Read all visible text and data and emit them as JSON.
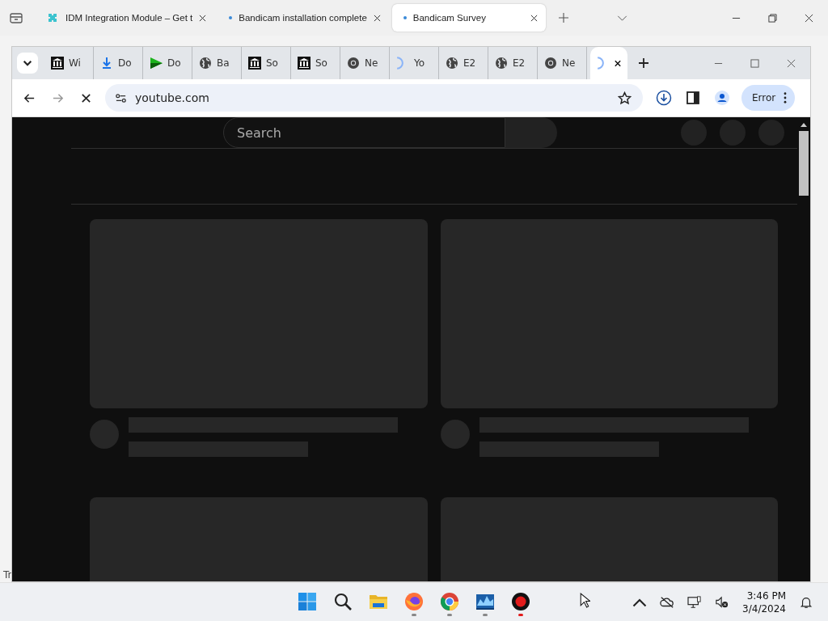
{
  "outer_tabs": [
    {
      "title": "IDM Integration Module – Get t",
      "kind": "puzzle",
      "selected": false
    },
    {
      "title": "Bandicam installation complete",
      "kind": "dot",
      "selected": false
    },
    {
      "title": "Bandicam Survey",
      "kind": "dot",
      "selected": true
    }
  ],
  "chrome_tabs": [
    {
      "title": "Wi",
      "kind": "museum",
      "selected": false
    },
    {
      "title": "Do",
      "kind": "download",
      "selected": false
    },
    {
      "title": "Do",
      "kind": "play",
      "selected": false
    },
    {
      "title": "Ba",
      "kind": "globe",
      "selected": false
    },
    {
      "title": "So",
      "kind": "museum",
      "selected": false
    },
    {
      "title": "So",
      "kind": "museum",
      "selected": false
    },
    {
      "title": "Ne",
      "kind": "chrome",
      "selected": false
    },
    {
      "title": "Yo",
      "kind": "loading",
      "selected": false
    },
    {
      "title": "E2",
      "kind": "globe",
      "selected": false
    },
    {
      "title": "E2",
      "kind": "globe",
      "selected": false
    },
    {
      "title": "Ne",
      "kind": "chrome",
      "selected": false
    },
    {
      "kind": "loading",
      "selected": true
    }
  ],
  "address": {
    "url": "youtube.com"
  },
  "profile_button": "Error",
  "page": {
    "search_placeholder": "Search"
  },
  "behind_text": "Tr",
  "taskbar": {
    "apps": [
      {
        "kind": "start",
        "running": false
      },
      {
        "kind": "search",
        "running": false
      },
      {
        "kind": "folder",
        "running": false
      },
      {
        "kind": "firefox",
        "running": true
      },
      {
        "kind": "chrome",
        "running": true
      },
      {
        "kind": "monitor",
        "running": true
      },
      {
        "kind": "record",
        "running": true
      }
    ],
    "time": "3:46 PM",
    "date": "3/4/2024"
  }
}
